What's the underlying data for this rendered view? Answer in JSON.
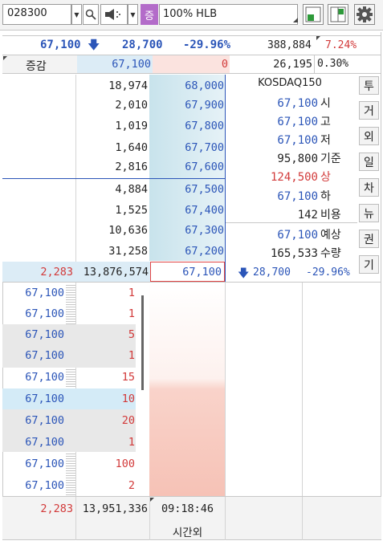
{
  "toolbar": {
    "code": "028300",
    "tag": "증",
    "ratio": "100%",
    "name": "HLB"
  },
  "summary": {
    "price": "67,100",
    "arrow": "🡇",
    "base": "28,700",
    "change": "-29.96%",
    "volume": "388,884",
    "turnover": "7.24%"
  },
  "row2": {
    "label": "증감",
    "sell_total": "67,100",
    "buy_total": "0",
    "right_val": "26,195",
    "right_pct": "0.30%"
  },
  "asks": [
    {
      "qty": "18,974",
      "price": "68,000"
    },
    {
      "qty": "2,010",
      "price": "67,900"
    },
    {
      "qty": "1,019",
      "price": "67,800"
    },
    {
      "qty": "1,640",
      "price": "67,700"
    },
    {
      "qty": "2,816",
      "price": "67,600"
    },
    {
      "qty": "4,884",
      "price": "67,500"
    },
    {
      "qty": "1,525",
      "price": "67,400"
    },
    {
      "qty": "10,636",
      "price": "67,300"
    },
    {
      "qty": "31,258",
      "price": "67,200"
    }
  ],
  "current": {
    "left": "2,283",
    "qty": "13,876,574",
    "price": "67,100"
  },
  "info": {
    "title": "KOSDAQ150",
    "rows": [
      {
        "val": "67,100",
        "label": "시",
        "color": "blue"
      },
      {
        "val": "67,100",
        "label": "고",
        "color": "blue"
      },
      {
        "val": "67,100",
        "label": "저",
        "color": "blue"
      },
      {
        "val": "95,800",
        "label": "기준",
        "color": "black"
      },
      {
        "val": "124,500",
        "label": "상",
        "color": "red"
      },
      {
        "val": "67,100",
        "label": "하",
        "color": "blue"
      },
      {
        "val": "142",
        "label": "비용",
        "color": "black"
      },
      {
        "val": "67,100",
        "label": "예상",
        "color": "blue"
      },
      {
        "val": "165,533",
        "label": "수량",
        "color": "black"
      }
    ],
    "bottom_arrow": "🡇",
    "bottom_val": "28,700",
    "bottom_pct": "-29.96%"
  },
  "side_tabs": [
    "투",
    "거",
    "외",
    "일",
    "차",
    "뉴",
    "권",
    "기"
  ],
  "trades": [
    {
      "price": "67,100",
      "qty": "1"
    },
    {
      "price": "67,100",
      "qty": "1"
    },
    {
      "price": "67,100",
      "qty": "5"
    },
    {
      "price": "67,100",
      "qty": "1"
    },
    {
      "price": "67,100",
      "qty": "15"
    },
    {
      "price": "67,100",
      "qty": "10"
    },
    {
      "price": "67,100",
      "qty": "20"
    },
    {
      "price": "67,100",
      "qty": "1"
    },
    {
      "price": "67,100",
      "qty": "100"
    },
    {
      "price": "67,100",
      "qty": "2"
    }
  ],
  "footer": {
    "left": "2,283",
    "total": "13,951,336",
    "time": "09:18:46",
    "label": "시간외"
  }
}
